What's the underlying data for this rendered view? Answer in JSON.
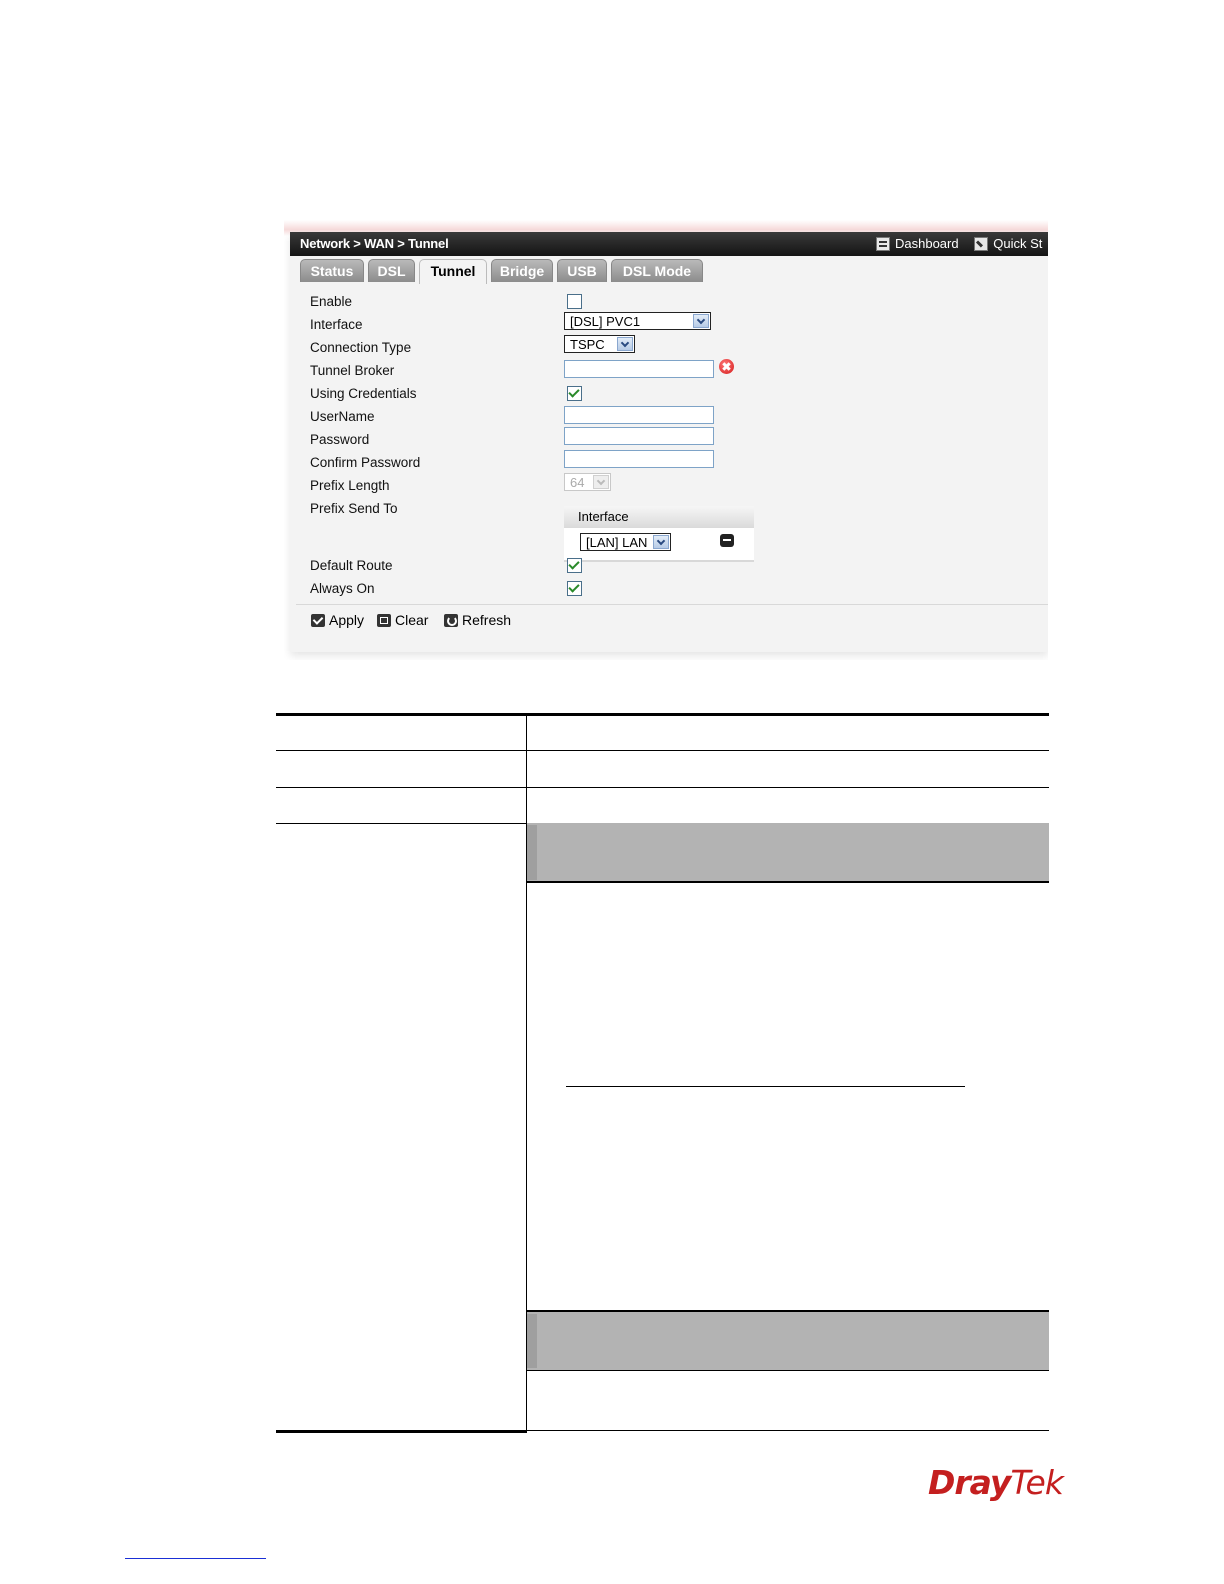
{
  "window": {
    "breadcrumb": "Network > WAN > Tunnel",
    "top_links": [
      {
        "label": "Dashboard",
        "icon": "dashboard-icon"
      },
      {
        "label": "Quick St",
        "icon": "quick-start-icon"
      }
    ]
  },
  "tabs": [
    "Status",
    "DSL",
    "Tunnel",
    "Bridge",
    "USB",
    "DSL Mode"
  ],
  "active_tab": "Tunnel",
  "form": {
    "enable": {
      "label": "Enable",
      "checked": false
    },
    "interface": {
      "label": "Interface",
      "value": "[DSL] PVC1"
    },
    "connection_type": {
      "label": "Connection Type",
      "value": "TSPC"
    },
    "tunnel_broker": {
      "label": "Tunnel Broker",
      "value": ""
    },
    "using_credentials": {
      "label": "Using Credentials",
      "checked": true
    },
    "username": {
      "label": "UserName",
      "value": ""
    },
    "password": {
      "label": "Password",
      "value": ""
    },
    "confirm_password": {
      "label": "Confirm Password",
      "value": ""
    },
    "prefix_length": {
      "label": "Prefix Length",
      "value": "64"
    },
    "prefix_send_to": {
      "label": "Prefix Send To",
      "column_header": "Interface",
      "value": "[LAN] LAN"
    },
    "default_route": {
      "label": "Default Route",
      "checked": true
    },
    "always_on": {
      "label": "Always On",
      "checked": true
    }
  },
  "actions": {
    "apply": "Apply",
    "clear": "Clear",
    "refresh": "Refresh"
  },
  "brand": {
    "logo_text_a": "Dray",
    "logo_text_b": "Tek",
    "logo_color": "#c41f1f"
  }
}
